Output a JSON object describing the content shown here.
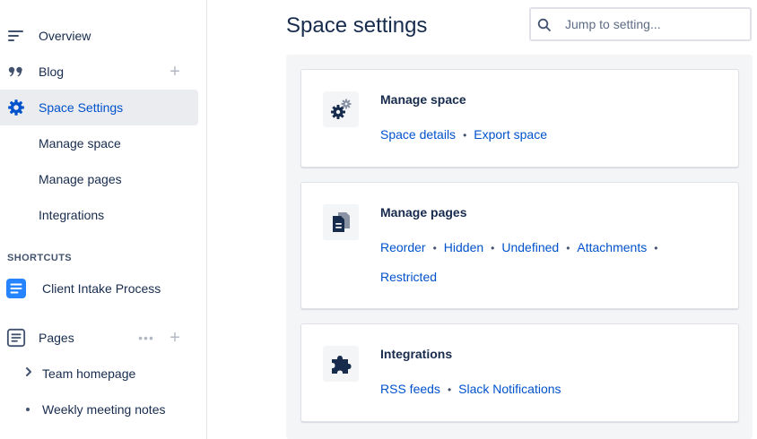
{
  "sidebar": {
    "items": [
      {
        "label": "Overview",
        "icon": "overview-icon"
      },
      {
        "label": "Blog",
        "icon": "quote-icon"
      },
      {
        "label": "Space Settings",
        "icon": "gear-icon",
        "active": true
      },
      {
        "label": "Manage space"
      },
      {
        "label": "Manage pages"
      },
      {
        "label": "Integrations"
      }
    ],
    "shortcuts_heading": "SHORTCUTS",
    "shortcut": {
      "label": "Client Intake Process",
      "icon": "document-icon"
    },
    "pages": {
      "label": "Pages",
      "icon": "pages-icon"
    },
    "page_children": [
      {
        "label": "Team homepage",
        "marker": "chevron-right-icon"
      },
      {
        "label": "Weekly meeting notes",
        "marker": "bullet"
      }
    ],
    "plus_glyph": "+",
    "more_glyph": "•••"
  },
  "main": {
    "title": "Space settings",
    "search": {
      "placeholder": "Jump to setting..."
    },
    "cards": [
      {
        "title": "Manage space",
        "icon": "gears-icon",
        "links": [
          "Space details",
          "Export space"
        ]
      },
      {
        "title": "Manage pages",
        "icon": "pages-copy-icon",
        "links": [
          "Reorder",
          "Hidden",
          "Undefined",
          "Attachments",
          "Restricted"
        ]
      },
      {
        "title": "Integrations",
        "icon": "puzzle-icon",
        "links": [
          "RSS feeds",
          "Slack Notifications"
        ]
      }
    ],
    "separator": "•"
  },
  "colors": {
    "accent": "#0052cc",
    "text": "#172b4d",
    "active_bg": "#ebecf0",
    "panel_bg": "#f4f5f7",
    "shortcut_icon": "#2684ff"
  }
}
